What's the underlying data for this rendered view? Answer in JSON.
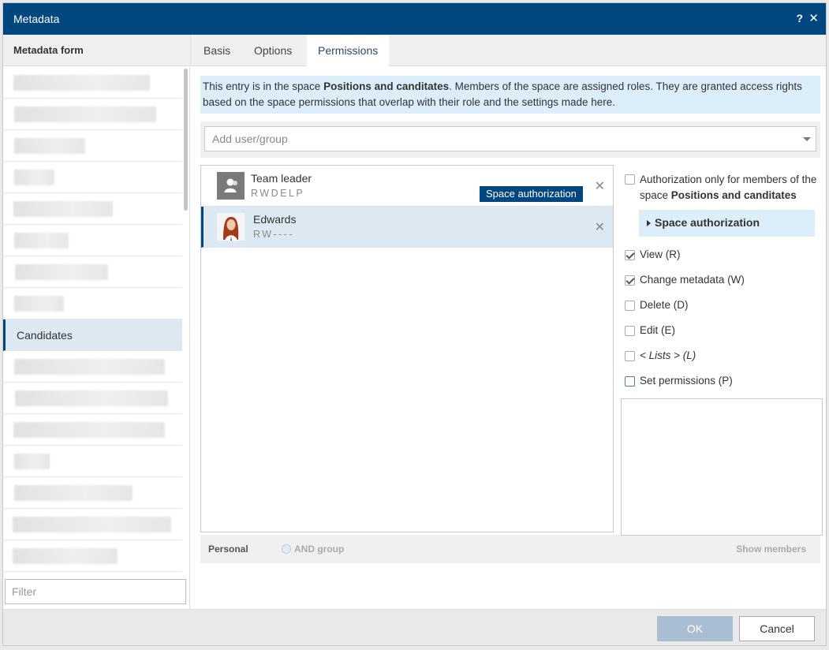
{
  "window": {
    "title": "Metadata",
    "help": "?",
    "close": "✕"
  },
  "left": {
    "header": "Metadata form",
    "active_item": "Candidates",
    "filter_placeholder": "Filter"
  },
  "tabs": [
    {
      "label": "Basis"
    },
    {
      "label": "Options"
    },
    {
      "label": "Permissions"
    }
  ],
  "info": {
    "part1": "This entry is in the space ",
    "space": "Positions and canditates",
    "part2": ". Members of the space are assigned roles. They are granted access rights based on the space permissions that overlap with their role and the settings made here."
  },
  "add_user": {
    "placeholder": "Add user/group"
  },
  "users": [
    {
      "name": "Team leader",
      "rights": "RWDELP",
      "badge": "Space authorization",
      "remove": "✕"
    },
    {
      "name": "Edwards",
      "rights": "RW----",
      "remove": "✕"
    }
  ],
  "footer": {
    "personal": "Personal",
    "and_group": "AND group",
    "show_members": "Show members"
  },
  "permissions": {
    "auth_only_prefix": "Authorization only for members of the space ",
    "auth_only_space": "Positions and canditates",
    "space_auth_label": "Space authorization",
    "items": [
      {
        "label": "View (R)",
        "checked": true
      },
      {
        "label": "Change metadata (W)",
        "checked": true
      },
      {
        "label": "Delete (D)",
        "checked": false
      },
      {
        "label": "Edit (E)",
        "checked": false
      },
      {
        "label": "< Lists > (L)",
        "checked": false
      },
      {
        "label": "Set permissions (P)",
        "checked": false
      }
    ]
  },
  "buttons": {
    "ok": "OK",
    "cancel": "Cancel"
  },
  "colors": {
    "titlebar": "#00467f",
    "selection": "#dde9f2",
    "info": "#ddeefb",
    "ok_disabled": "#a9bed3"
  }
}
